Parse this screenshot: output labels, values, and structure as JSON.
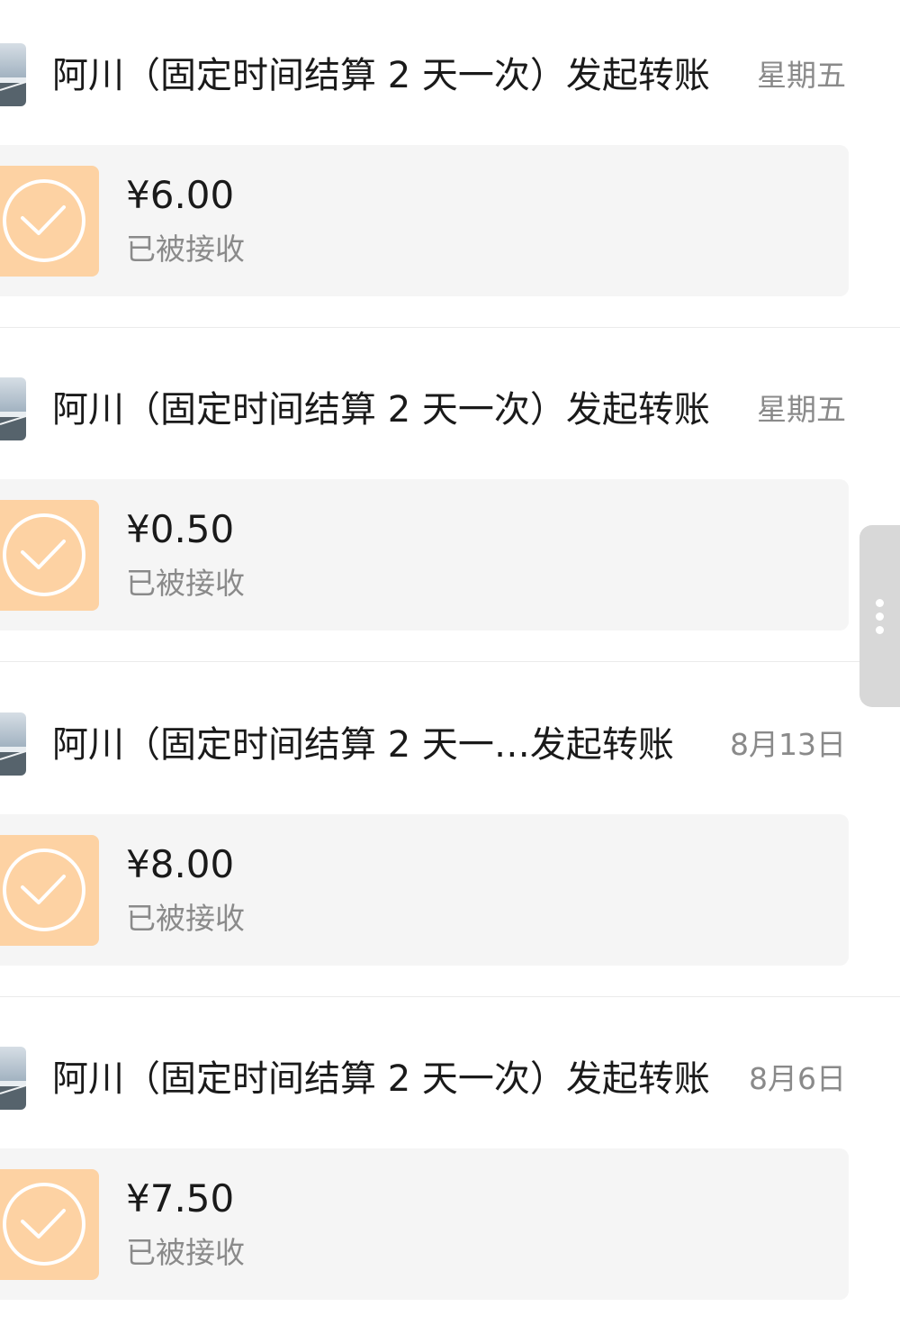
{
  "transfers": [
    {
      "sender": "阿川（固定时间结算 2 天一次）",
      "action": "发起转账",
      "date": "星期五",
      "amount": "¥6.00",
      "status": "已被接收"
    },
    {
      "sender": "阿川（固定时间结算 2 天一次）",
      "action": "发起转账",
      "date": "星期五",
      "amount": "¥0.50",
      "status": "已被接收"
    },
    {
      "sender": "阿川（固定时间结算 2 天一…",
      "action": "发起转账",
      "date": "8月13日",
      "amount": "¥8.00",
      "status": "已被接收"
    },
    {
      "sender": "阿川（固定时间结算 2 天一次）",
      "action": "发起转账",
      "date": "8月6日",
      "amount": "¥7.50",
      "status": "已被接收"
    }
  ],
  "icons": {
    "avatar": "avatar-photo",
    "transfer_status": "check-circle-icon",
    "scroll_handle": "vertical-dots-icon"
  },
  "colors": {
    "accent": "#fdd2a3",
    "card_background": "#f5f5f5",
    "text": "#1a1a1a",
    "muted_text": "#8a8a8a",
    "divider": "#ebebeb",
    "scroll_handle": "#d8d8d8"
  }
}
